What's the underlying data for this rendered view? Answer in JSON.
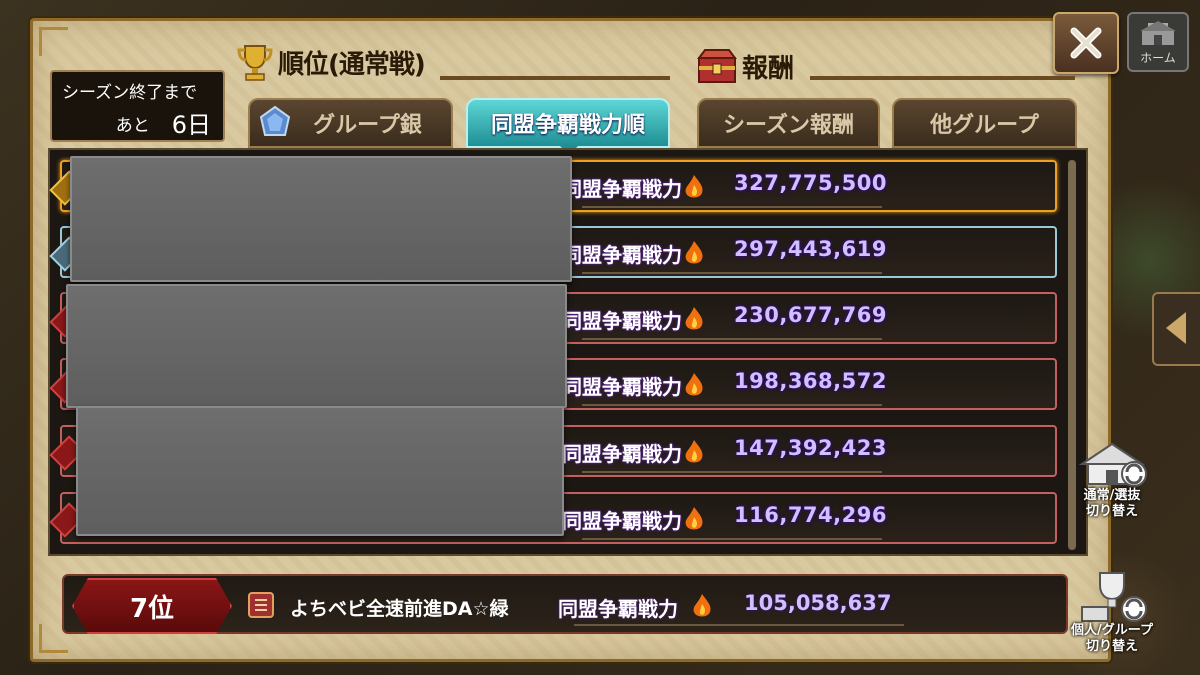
{
  "header": {
    "rank_title": "順位(通常戦)",
    "reward_title": "報酬",
    "close_icon": "close-icon",
    "home_label": "ホーム"
  },
  "season": {
    "line1": "シーズン終了まで",
    "prefix": "あと",
    "days": "6日"
  },
  "tabs": [
    {
      "label": "グループ銀",
      "active": false
    },
    {
      "label": "同盟争覇戦力順",
      "active": true
    },
    {
      "label": "シーズン報酬",
      "active": false
    },
    {
      "label": "他グループ",
      "active": false
    }
  ],
  "rows": [
    {
      "power_label": "同盟争覇戦力",
      "power": "327,775,500"
    },
    {
      "power_label": "同盟争覇戦力",
      "power": "297,443,619"
    },
    {
      "power_label": "同盟争覇戦力",
      "power": "230,677,769"
    },
    {
      "power_label": "同盟争覇戦力",
      "power": "198,368,572"
    },
    {
      "power_label": "同盟争覇戦力",
      "power": "147,392,423"
    },
    {
      "power_label": "同盟争覇戦力",
      "power": "116,774,296"
    }
  ],
  "my_rank": {
    "rank": "7位",
    "alliance_name": "よちベビ全速前進DA☆緑",
    "power_label": "同盟争覇戦力",
    "power": "105,058,637"
  },
  "side_buttons": {
    "normal_switch": "通常/選抜\n切り替え",
    "normal_line1": "通常/選抜",
    "normal_line2": "切り替え",
    "personal_line1": "個人/グループ",
    "personal_line2": "切り替え"
  },
  "colors": {
    "accent_tab": "#1f8f95",
    "gold_border": "#f0a020",
    "silver_border": "#9ac8d8",
    "red_border": "#c46060",
    "power_value": "#d0c0ff"
  }
}
